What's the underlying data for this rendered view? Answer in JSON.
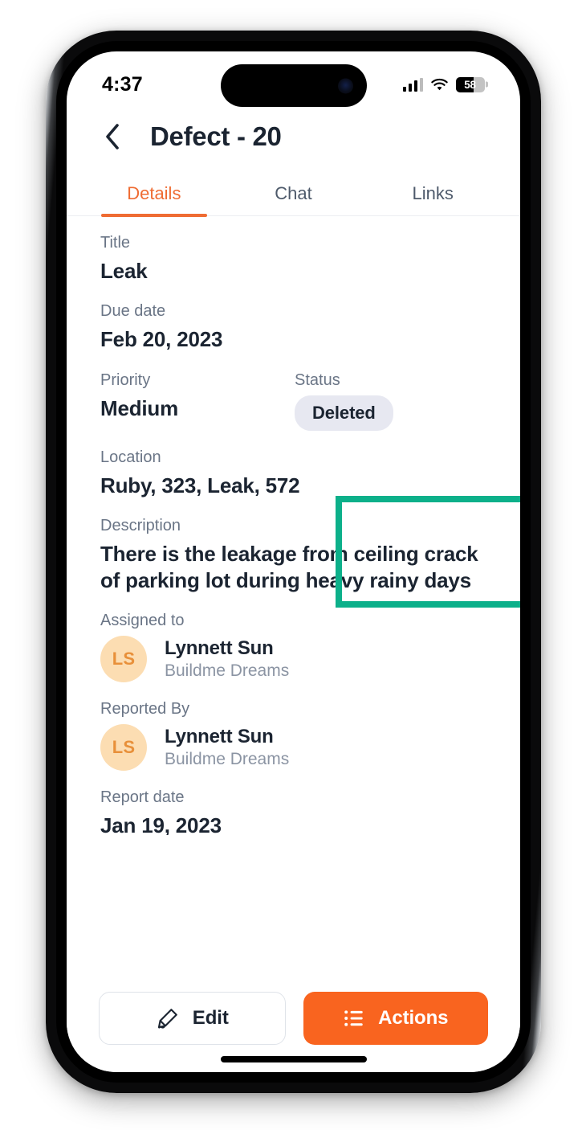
{
  "status_bar": {
    "time": "4:37",
    "signal_icon": "cellular-signal-icon",
    "wifi_icon": "wifi-icon",
    "battery_level": "58",
    "battery_icon": "battery-icon"
  },
  "header": {
    "back_icon": "chevron-left-icon",
    "title": "Defect - 20"
  },
  "tabs": [
    {
      "label": "Details",
      "active": true
    },
    {
      "label": "Chat",
      "active": false
    },
    {
      "label": "Links",
      "active": false
    }
  ],
  "details": {
    "title": {
      "label": "Title",
      "value": "Leak"
    },
    "due_date": {
      "label": "Due date",
      "value": "Feb 20, 2023"
    },
    "priority": {
      "label": "Priority",
      "value": "Medium"
    },
    "status": {
      "label": "Status",
      "value": "Deleted"
    },
    "location": {
      "label": "Location",
      "value": "Ruby, 323, Leak, 572"
    },
    "description": {
      "label": "Description",
      "value": "There is the leakage from ceiling crack of parking lot during heavy rainy days"
    },
    "assigned_to": {
      "label": "Assigned to",
      "initials": "LS",
      "name": "Lynnett Sun",
      "org": "Buildme Dreams"
    },
    "reported_by": {
      "label": "Reported By",
      "initials": "LS",
      "name": "Lynnett Sun",
      "org": "Buildme Dreams"
    },
    "report_date": {
      "label": "Report date",
      "value": "Jan 19, 2023"
    }
  },
  "bottom_bar": {
    "edit": {
      "label": "Edit",
      "icon": "pencil-icon"
    },
    "actions": {
      "label": "Actions",
      "icon": "list-icon"
    }
  },
  "annotation": {
    "highlight_target": "status-field",
    "highlight_color": "#0cb08a"
  },
  "colors": {
    "accent_orange": "#f9641f",
    "tab_orange": "#ef6c33",
    "text_dark": "#1b2431",
    "text_muted": "#6a7586",
    "pill_bg": "#e7e8f1",
    "avatar_bg": "#fcddb2",
    "avatar_text": "#e8903a"
  }
}
